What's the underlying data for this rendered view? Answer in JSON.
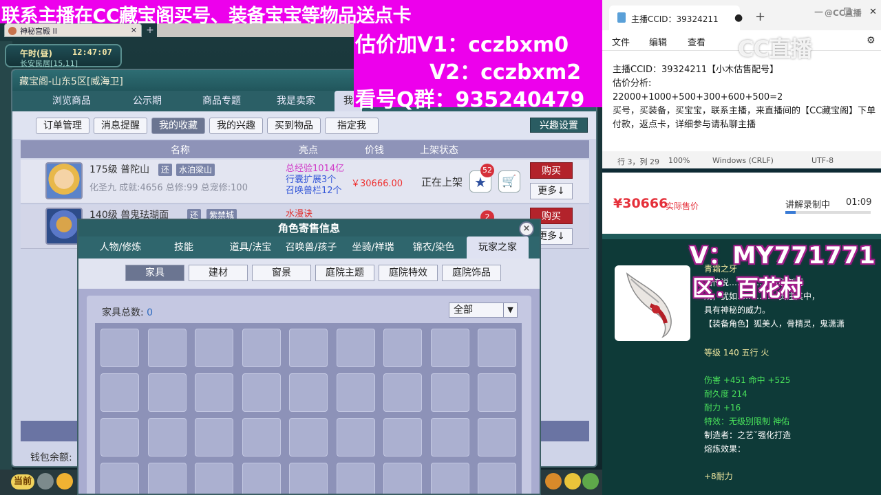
{
  "banner": {
    "headline": "联系主播在CC藏宝阁买号、装备宝宝等物品送点卡",
    "v1": "估价加V1：cczbxm0",
    "v2": "V2：cczbxm2",
    "qq": "看号Q群：935240479"
  },
  "browser": {
    "tab_label": "神秘宫殿 II"
  },
  "clock": {
    "shichen": "午时(昼)",
    "time": "12:47:07",
    "location": "长安民居[15,11]"
  },
  "cbg": {
    "title": "藏宝阁-山东5区[威海卫]",
    "tabs": [
      "浏览商品",
      "公示期",
      "商品专题",
      "我是卖家",
      "我"
    ],
    "subtabs": [
      "订单管理",
      "消息提醒",
      "我的收藏",
      "我的兴趣",
      "买到物品",
      "指定我"
    ],
    "active_subtab": "我的收藏",
    "interest_button": "兴趣设置",
    "columns": [
      "名称",
      "亮点",
      "价钱",
      "上架状态"
    ],
    "rows": [
      {
        "name": "175级  普陀山",
        "tag1": "还",
        "tag2": "水泊梁山",
        "stats": "化圣九 成就:4656 总修:99 总宠修:100",
        "highlights": [
          "总经验1014亿",
          "行囊扩展3个",
          "召唤兽栏12个"
        ],
        "price": "￥30666.00",
        "status": "正在上架",
        "fav_count": "52",
        "buy": "购买",
        "more": "更多↓"
      },
      {
        "name": "140级  兽鬼珐瑚面",
        "tag1": "还",
        "tag2": "紫禁城",
        "highlights": [
          "水漫诀"
        ],
        "fav_count": "2",
        "buy": "购买",
        "more": "更多↓"
      }
    ],
    "wallet_label": "钱包余额:"
  },
  "bottom": {
    "now_label": "当前"
  },
  "dialog": {
    "title": "角色寄售信息",
    "tabs": [
      "人物/修炼",
      "技能",
      "道具/法宝",
      "召唤兽/孩子",
      "坐骑/祥瑞",
      "锦衣/染色",
      "玩家之家"
    ],
    "active_tab": "玩家之家",
    "chips": [
      "家具",
      "建材",
      "窗景",
      "庭院主题",
      "庭院特效",
      "庭院饰品"
    ],
    "active_chip": "家具",
    "total_label": "家具总数:",
    "total_value": "0",
    "filter_value": "全部",
    "close": "×"
  },
  "notepad": {
    "tab_title": "主播CCID：39324211",
    "menu": [
      "文件",
      "编辑",
      "查看"
    ],
    "lines": [
      "主播CCID：39324211【小木估售配号】",
      "估价分析:",
      "22000+1000+500+300+600+500=2",
      "买号，买装备，买宝宝，联系主播，来直播间的【CC藏宝阁】下单付款，返点卡，详细参与请私聊主播"
    ],
    "status": {
      "position": "行 3，列 29",
      "zoom": "100%",
      "eol": "Windows (CRLF)",
      "enc": "UTF-8"
    },
    "logo": "CC直播",
    "logo_small": "@CC直播"
  },
  "stream": {
    "price": "¥30666",
    "price_note": "实际售价",
    "recording": "讲解录制中",
    "time": "01:09",
    "progress": 0.12
  },
  "tooltip": {
    "vtag": "V：MY771771",
    "qtag": "区：百花村",
    "name": "青霜之牙",
    "desc1": "据传说…………牙所雕刻而",
    "desc2": "成，犹如……………贯注其中，",
    "desc3": "具有神秘的威力。",
    "roles": "【装备角色】狐美人，骨精灵，鬼潇潇",
    "level": "等级 140  五行 火",
    "attack": "伤害 +451  命中 +525",
    "durability": "耐久度 214",
    "stamina": "耐力 +16",
    "special": "特效：无级别限制 神佑",
    "maker": "制造者：之艺ˇ强化打造",
    "refine": "熔炼效果：",
    "refine_val": "+8耐力"
  },
  "colors": {
    "magenta": "#ed00ec",
    "teal": "#2b5e64",
    "buy_red": "#b3232b"
  }
}
